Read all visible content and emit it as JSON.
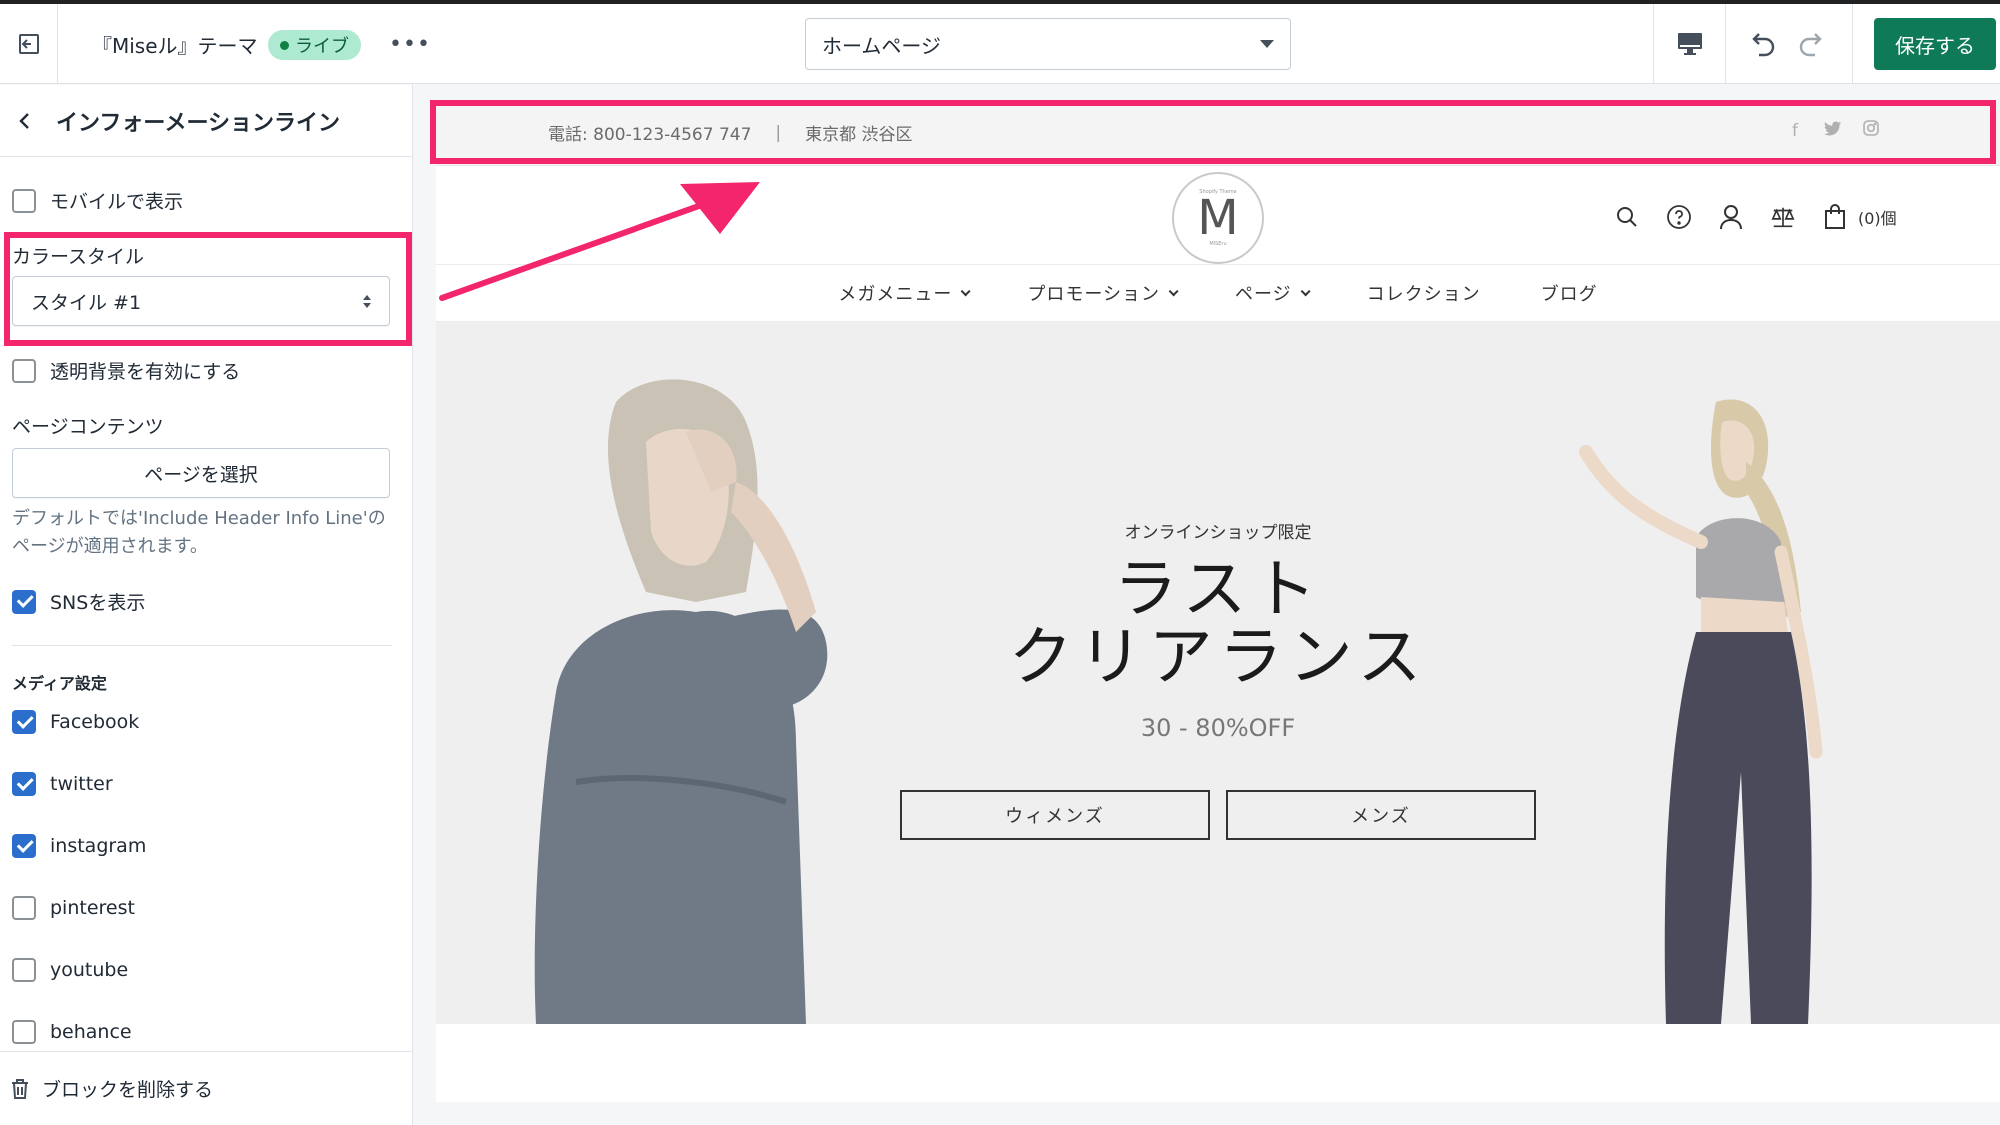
{
  "topbar": {
    "theme_title": "『Miseル』テーマ",
    "live_label": "ライブ",
    "more_label": "•••",
    "page_select_value": "ホームページ",
    "save_label": "保存する"
  },
  "sidebar": {
    "title": "インフォーメーションライン",
    "show_mobile_label": "モバイルで表示",
    "color_style_label": "カラースタイル",
    "color_style_value": "スタイル #1",
    "transparent_label": "透明背景を有効にする",
    "page_content_label": "ページコンテンツ",
    "select_page_label": "ページを選択",
    "help_text": "デフォルトでは'Include Header Info Line'のページが適用されます。",
    "show_sns_label": "SNSを表示",
    "media_heading": "メディア設定",
    "media_items": [
      {
        "label": "Facebook",
        "checked": true
      },
      {
        "label": "twitter",
        "checked": true
      },
      {
        "label": "instagram",
        "checked": true
      },
      {
        "label": "pinterest",
        "checked": false
      },
      {
        "label": "youtube",
        "checked": false
      },
      {
        "label": "behance",
        "checked": false
      }
    ],
    "delete_label": "ブロックを削除する"
  },
  "preview": {
    "info_phone": "電話: 800-123-4567 747",
    "info_separator": "|",
    "info_address": "東京都 渋谷区",
    "sns_icons": [
      "facebook-icon",
      "twitter-icon",
      "instagram-icon"
    ],
    "logo_small_text": "Shopify Theme",
    "logo_letter": "M",
    "logo_caption": "MISEru",
    "cart_count": "(0)個",
    "nav": [
      "メガメニュー",
      "プロモーション",
      "ページ",
      "コレクション",
      "ブログ"
    ],
    "hero_sub": "オンラインショップ限定",
    "hero_title_line1": "ラスト",
    "hero_title_line2": "クリアランス",
    "hero_off": "30 - 80%OFF",
    "btn_women": "ウィメンズ",
    "btn_men": "メンズ"
  },
  "colors": {
    "accent_highlight": "#f2256d",
    "save_button": "#0f7a57",
    "checkbox_checked": "#2c6ecb",
    "live_badge": "#aee9d1"
  }
}
